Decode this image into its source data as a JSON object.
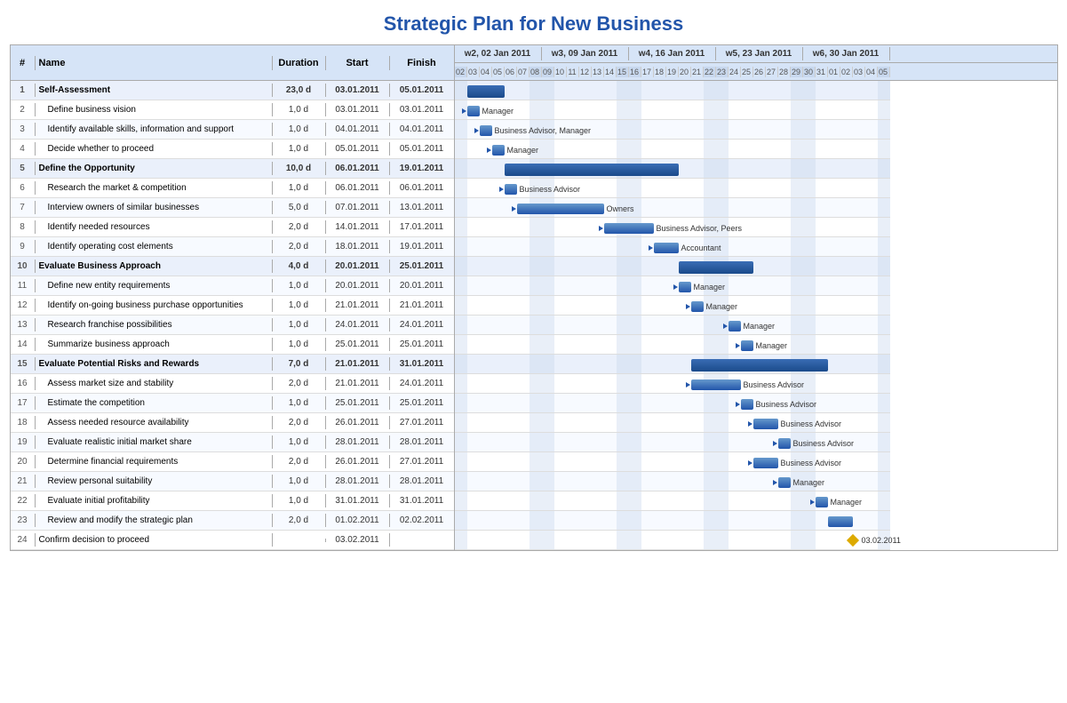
{
  "title": "Strategic Plan for New Business",
  "columns": {
    "num": "#",
    "name": "Name",
    "duration": "Duration",
    "start": "Start",
    "finish": "Finish"
  },
  "weeks": [
    {
      "label": "w2, 02 Jan 2011",
      "days": 7
    },
    {
      "label": "w3, 09 Jan 2011",
      "days": 7
    },
    {
      "label": "w4, 16 Jan 2011",
      "days": 7
    },
    {
      "label": "w5, 23 Jan 2011",
      "days": 7
    },
    {
      "label": "w6, 30 Jan 2011",
      "days": 7
    }
  ],
  "days": [
    "02",
    "03",
    "04",
    "05",
    "06",
    "07",
    "08",
    "09",
    "10",
    "11",
    "12",
    "13",
    "14",
    "15",
    "16",
    "17",
    "18",
    "19",
    "20",
    "21",
    "22",
    "23",
    "24",
    "25",
    "26",
    "27",
    "28",
    "29",
    "30",
    "31",
    "01",
    "02",
    "03",
    "04",
    "05"
  ],
  "tasks": [
    {
      "num": 1,
      "name": "Self-Assessment",
      "duration": "23,0 d",
      "start": "03.01.2011",
      "finish": "05.01.2011",
      "group": true
    },
    {
      "num": 2,
      "name": "Define business vision",
      "duration": "1,0 d",
      "start": "03.01.2011",
      "finish": "03.01.2011",
      "group": false,
      "indent": 1
    },
    {
      "num": 3,
      "name": "Identify available skills, information and support",
      "duration": "1,0 d",
      "start": "04.01.2011",
      "finish": "04.01.2011",
      "group": false,
      "indent": 1
    },
    {
      "num": 4,
      "name": "Decide whether to proceed",
      "duration": "1,0 d",
      "start": "05.01.2011",
      "finish": "05.01.2011",
      "group": false,
      "indent": 1
    },
    {
      "num": 5,
      "name": "Define the Opportunity",
      "duration": "10,0 d",
      "start": "06.01.2011",
      "finish": "19.01.2011",
      "group": true
    },
    {
      "num": 6,
      "name": "Research the market & competition",
      "duration": "1,0 d",
      "start": "06.01.2011",
      "finish": "06.01.2011",
      "group": false,
      "indent": 1
    },
    {
      "num": 7,
      "name": "Interview owners of similar businesses",
      "duration": "5,0 d",
      "start": "07.01.2011",
      "finish": "13.01.2011",
      "group": false,
      "indent": 1
    },
    {
      "num": 8,
      "name": "Identify needed resources",
      "duration": "2,0 d",
      "start": "14.01.2011",
      "finish": "17.01.2011",
      "group": false,
      "indent": 1
    },
    {
      "num": 9,
      "name": "Identify operating cost elements",
      "duration": "2,0 d",
      "start": "18.01.2011",
      "finish": "19.01.2011",
      "group": false,
      "indent": 1
    },
    {
      "num": 10,
      "name": "Evaluate Business Approach",
      "duration": "4,0 d",
      "start": "20.01.2011",
      "finish": "25.01.2011",
      "group": true
    },
    {
      "num": 11,
      "name": "Define new entity requirements",
      "duration": "1,0 d",
      "start": "20.01.2011",
      "finish": "20.01.2011",
      "group": false,
      "indent": 1
    },
    {
      "num": 12,
      "name": "Identify on-going business purchase opportunities",
      "duration": "1,0 d",
      "start": "21.01.2011",
      "finish": "21.01.2011",
      "group": false,
      "indent": 1
    },
    {
      "num": 13,
      "name": "Research franchise possibilities",
      "duration": "1,0 d",
      "start": "24.01.2011",
      "finish": "24.01.2011",
      "group": false,
      "indent": 1
    },
    {
      "num": 14,
      "name": "Summarize business approach",
      "duration": "1,0 d",
      "start": "25.01.2011",
      "finish": "25.01.2011",
      "group": false,
      "indent": 1
    },
    {
      "num": 15,
      "name": "Evaluate Potential Risks and Rewards",
      "duration": "7,0 d",
      "start": "21.01.2011",
      "finish": "31.01.2011",
      "group": true
    },
    {
      "num": 16,
      "name": "Assess market size and stability",
      "duration": "2,0 d",
      "start": "21.01.2011",
      "finish": "24.01.2011",
      "group": false,
      "indent": 1
    },
    {
      "num": 17,
      "name": "Estimate the competition",
      "duration": "1,0 d",
      "start": "25.01.2011",
      "finish": "25.01.2011",
      "group": false,
      "indent": 1
    },
    {
      "num": 18,
      "name": "Assess needed resource availability",
      "duration": "2,0 d",
      "start": "26.01.2011",
      "finish": "27.01.2011",
      "group": false,
      "indent": 1
    },
    {
      "num": 19,
      "name": "Evaluate realistic initial market share",
      "duration": "1,0 d",
      "start": "28.01.2011",
      "finish": "28.01.2011",
      "group": false,
      "indent": 1
    },
    {
      "num": 20,
      "name": "Determine financial requirements",
      "duration": "2,0 d",
      "start": "26.01.2011",
      "finish": "27.01.2011",
      "group": false,
      "indent": 1
    },
    {
      "num": 21,
      "name": "Review personal suitability",
      "duration": "1,0 d",
      "start": "28.01.2011",
      "finish": "28.01.2011",
      "group": false,
      "indent": 1
    },
    {
      "num": 22,
      "name": "Evaluate initial profitability",
      "duration": "1,0 d",
      "start": "31.01.2011",
      "finish": "31.01.2011",
      "group": false,
      "indent": 1
    },
    {
      "num": 23,
      "name": "Review and modify the strategic plan",
      "duration": "2,0 d",
      "start": "01.02.2011",
      "finish": "02.02.2011",
      "group": false,
      "indent": 1
    },
    {
      "num": 24,
      "name": "Confirm decision to proceed",
      "duration": "",
      "start": "03.02.2011",
      "finish": "",
      "group": false,
      "milestone": true
    }
  ]
}
